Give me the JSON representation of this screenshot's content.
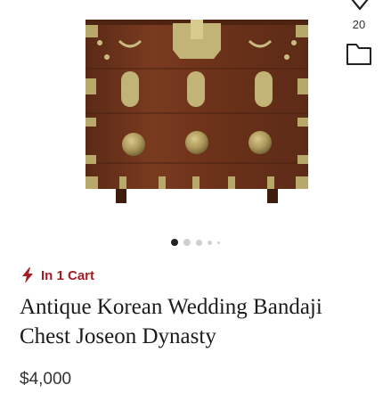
{
  "favorites": {
    "icon": "heart-outline-icon",
    "count": "20"
  },
  "collection": {
    "icon": "folder-icon"
  },
  "carousel": {
    "total": 5,
    "active_index": 0
  },
  "cart_status": {
    "icon": "lightning-icon",
    "label": "In 1 Cart",
    "color": "#a51c24"
  },
  "product": {
    "title": "Antique Korean Wedding Bandaji Chest Joseon Dynasty",
    "price": "$4,000"
  }
}
